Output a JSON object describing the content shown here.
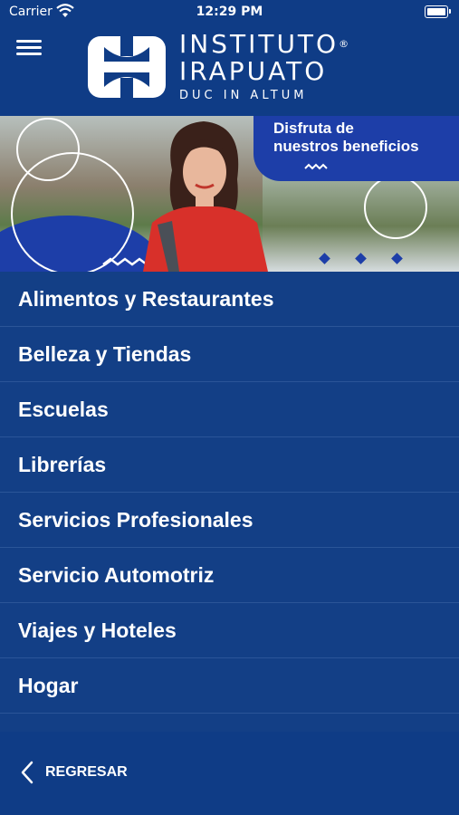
{
  "status_bar": {
    "carrier": "Carrier",
    "time": "12:29 PM"
  },
  "header": {
    "brand_line1": "INSTITUTO",
    "brand_line2": "IRAPUATO",
    "registered_mark": "®",
    "tagline": "DUC IN ALTUM"
  },
  "banner": {
    "promo_line1": "Disfruta de",
    "promo_line2": "nuestros beneficios"
  },
  "categories": [
    {
      "label": "Alimentos y Restaurantes"
    },
    {
      "label": "Belleza y Tiendas"
    },
    {
      "label": "Escuelas"
    },
    {
      "label": "Librerías"
    },
    {
      "label": "Servicios  Profesionales"
    },
    {
      "label": "Servicio Automotriz"
    },
    {
      "label": "Viajes y Hoteles"
    },
    {
      "label": "Hogar"
    }
  ],
  "footer": {
    "back_label": "REGRESAR"
  },
  "colors": {
    "primary": "#0f3c86",
    "list_bg": "#133f86",
    "banner_blue": "#1d3ea8",
    "text": "#ffffff"
  }
}
